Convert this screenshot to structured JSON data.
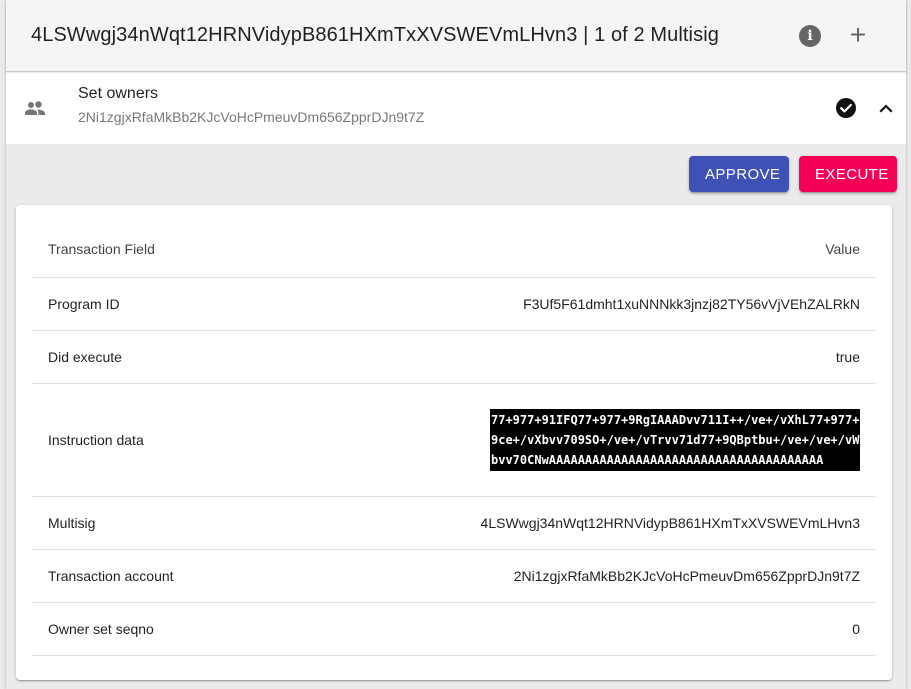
{
  "header": {
    "title": "4LSWwgj34nWqt12HRNVidypB861HXmTxXVSWEVmLHvn3 | 1 of 2 Multisig"
  },
  "transaction": {
    "primary": "Set owners",
    "secondary": "2Ni1zgjxRfaMkBb2KJcVoHcPmeuvDm656ZpprDJn9t7Z"
  },
  "actions": {
    "approve_label": "APPROVE",
    "execute_label": "EXECUTE"
  },
  "table": {
    "header": {
      "field": "Transaction Field",
      "value": "Value"
    },
    "rows": [
      {
        "field": "Program ID",
        "value": "F3Uf5F61dmht1xuNNNkk3jnzj82TY56vVjVEhZALRkN"
      },
      {
        "field": "Did execute",
        "value": "true"
      },
      {
        "field": "Instruction data",
        "value": "77+977+91IFQ77+977+9RgIAAADvv711I++/ve+/vXhL77+977+9ce+/vXbvv709SO+/ve+/vTrvv71d77+9QBptbu+/ve+/ve+/vWbvv70CNwAAAAAAAAAAAAAAAAAAAAAAAAAAAAAAAAAAAAAA"
      },
      {
        "field": "Multisig",
        "value": "4LSWwgj34nWqt12HRNVidypB861HXmTxXVSWEVmLHvn3"
      },
      {
        "field": "Transaction account",
        "value": "2Ni1zgjxRfaMkBb2KJcVoHcPmeuvDm656ZpprDJn9t7Z"
      },
      {
        "field": "Owner set seqno",
        "value": "0"
      }
    ]
  },
  "icons": {
    "info": "info-icon",
    "add": "plus-icon",
    "people": "people-icon",
    "check": "check-circle-icon",
    "collapse": "chevron-up-icon"
  },
  "colors": {
    "primary": "#3f51b5",
    "secondary": "#f50057"
  }
}
